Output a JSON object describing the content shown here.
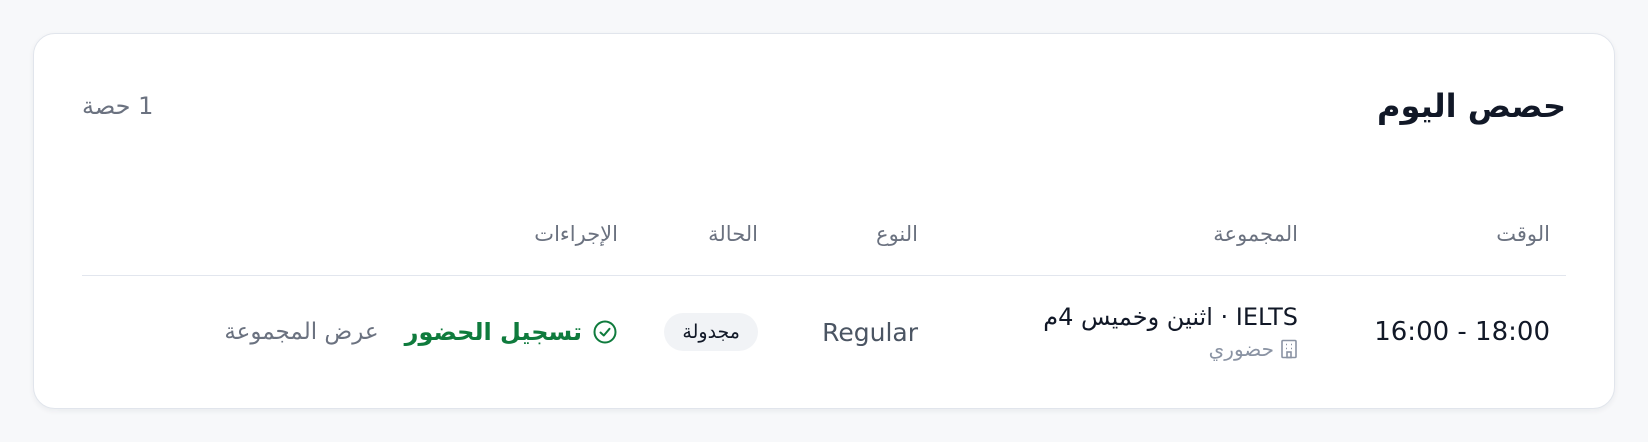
{
  "card": {
    "title": "حصص اليوم",
    "count": "1 حصة"
  },
  "table": {
    "headers": {
      "time": "الوقت",
      "group": "المجموعة",
      "type": "النوع",
      "status": "الحالة",
      "actions": "الإجراءات"
    },
    "rows": [
      {
        "time": "16:00 - 18:00",
        "group_name": "IELTS · اثنين وخميس 4م",
        "group_mode": "حضوري",
        "group_mode_icon": "building-icon",
        "type": "Regular",
        "status": "مجدولة",
        "action_attendance": "تسجيل الحضور",
        "action_attendance_icon": "check-circle-icon",
        "action_view_group": "عرض المجموعة"
      }
    ]
  },
  "colors": {
    "accent_green": "#0f7b3d",
    "muted_text": "#6b7280",
    "badge_bg": "#f1f3f6"
  }
}
